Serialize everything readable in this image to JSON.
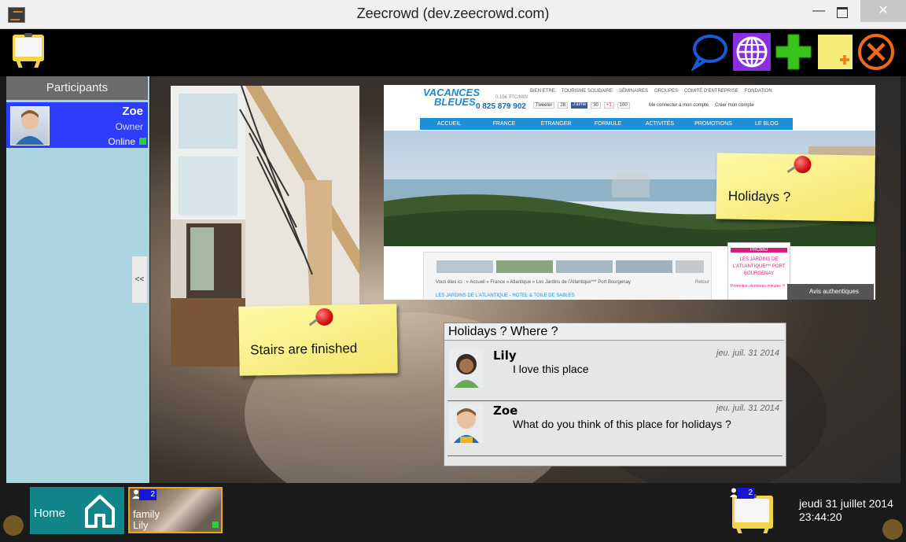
{
  "window": {
    "title": "Zeecrowd (dev.zeecrowd.com)",
    "minimize_label": "—",
    "close_label": "✕"
  },
  "toolbar": {
    "buttons": [
      "chat-bubble-icon",
      "globe-icon",
      "add-icon",
      "new-note-icon",
      "close-circle-icon"
    ],
    "colors": {
      "chat": "#1a5ad8",
      "globe_bg": "#8b2de0",
      "add": "#37c41a",
      "note": "#f7eb7a",
      "close": "#ef6a16"
    }
  },
  "sidebar": {
    "header": "Participants",
    "collapse_label": "<<",
    "participants": [
      {
        "name": "Zoe",
        "role": "Owner",
        "status": "Online"
      }
    ]
  },
  "workspace": {
    "notes": [
      {
        "text": "Holidays ?"
      },
      {
        "text": "Stairs are finished"
      }
    ],
    "website": {
      "brand_line1": "VACANCES",
      "brand_line2": "BLEUES",
      "phone": "0 825 879 902",
      "phone_caption": "0,15€ TTC/MIN",
      "top_links": [
        "BIEN ETRE",
        "TOURISME SOLIDAIRE",
        "SÉMINAIRES",
        "GROUPES",
        "COMITÉ D'ENTREPRISE",
        "FONDATION"
      ],
      "social": [
        "Tweeter",
        "28",
        "J'aime",
        "30",
        "+1",
        "100"
      ],
      "account_links": [
        "Me connecter à mon compte",
        "Créer mon compte"
      ],
      "nav": [
        "ACCUEIL",
        "FRANCE",
        "ETRANGER",
        "FORMULE",
        "ACTIVITÉS",
        "PROMOTIONS",
        "LE BLOG"
      ],
      "breadcrumb": "Vous êtes ici : » Accueil » France » Atlantique » Les Jardins de l'Atlantique*** Port Bourgenay",
      "back_label": "Retour",
      "promo_title": "PROMO",
      "promo_text": "LES JARDINS DE L'ATLANTIQUE*** PORT BOURGENAY",
      "promo_sub": "Promotion dernières minutes !!!",
      "reviews_label": "Avis authentiques",
      "bottom_text": "LES JARDINS DE L'ATLANTIQUE - HOTEL & TOILE DE SABLES"
    },
    "chat": {
      "title": "Holidays ? Where ?",
      "messages": [
        {
          "author": "Lily",
          "date": "jeu. juil. 31 2014",
          "text": "I love this place"
        },
        {
          "author": "Zoe",
          "date": "jeu. juil. 31 2014",
          "text": "What do you think of this place for holidays ?"
        }
      ]
    }
  },
  "bottombar": {
    "home_label": "Home",
    "family_tile": {
      "line1": "family",
      "line2": "Lily",
      "badge": "2"
    },
    "board_badge": "2",
    "date": "jeudi 31 juillet 2014",
    "time": "23:44:20"
  }
}
